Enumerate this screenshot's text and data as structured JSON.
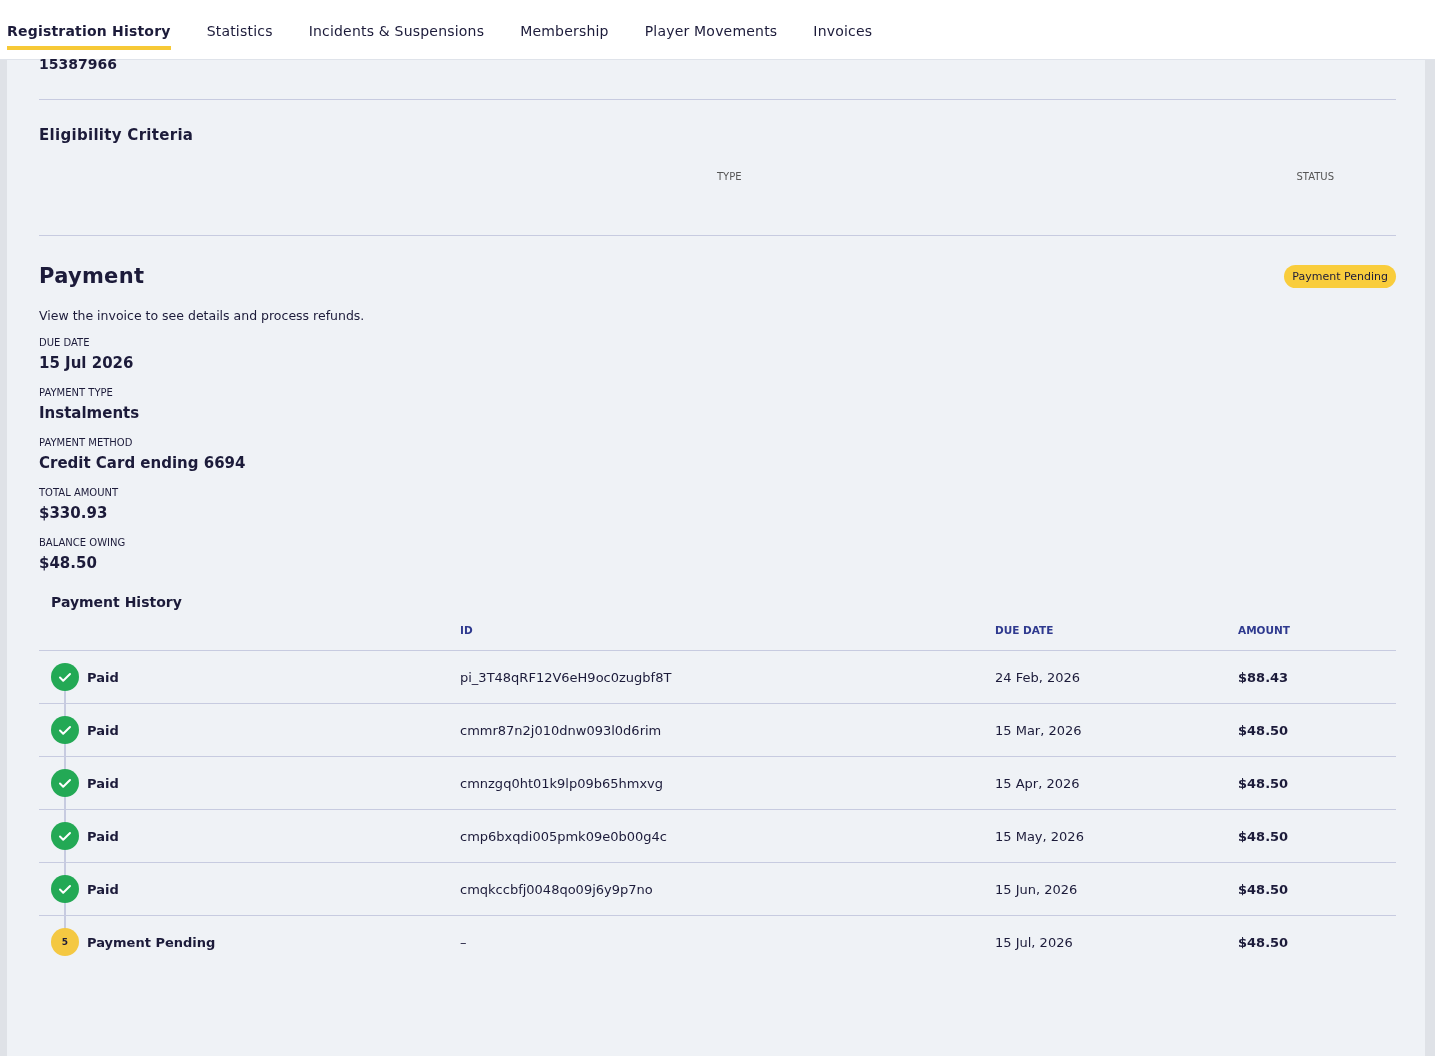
{
  "tabs": [
    {
      "label": "Registration History",
      "selected": true
    },
    {
      "label": "Statistics",
      "selected": false
    },
    {
      "label": "Incidents & Suspensions",
      "selected": false
    },
    {
      "label": "Membership",
      "selected": false
    },
    {
      "label": "Player Movements",
      "selected": false
    },
    {
      "label": "Invoices",
      "selected": false
    }
  ],
  "registration_number": "15387966",
  "eligibility": {
    "title": "Eligibility Criteria",
    "columns": [
      "TYPE",
      "STATUS"
    ]
  },
  "payment": {
    "title": "Payment",
    "badge": "Payment Pending",
    "description": "View the invoice to see details and process refunds.",
    "fields": [
      {
        "label": "DUE DATE",
        "value": "15 Jul 2026"
      },
      {
        "label": "PAYMENT TYPE",
        "value": "Instalments"
      },
      {
        "label": "PAYMENT METHOD",
        "value": "Credit Card ending 6694"
      },
      {
        "label": "TOTAL AMOUNT",
        "value": "$330.93"
      },
      {
        "label": "BALANCE OWING",
        "value": "$48.50"
      }
    ]
  },
  "payment_history": {
    "title": "Payment History",
    "columns": [
      "ID",
      "DUE DATE",
      "AMOUNT"
    ],
    "rows": [
      {
        "kind": "paid",
        "status": "Paid",
        "id": "pi_3T48qRF12V6eH9oc0zugbf8T",
        "due_date": "24 Feb, 2026",
        "amount": "$88.43"
      },
      {
        "kind": "paid",
        "status": "Paid",
        "id": "cmmr87n2j010dnw093l0d6rim",
        "due_date": "15 Mar, 2026",
        "amount": "$48.50"
      },
      {
        "kind": "paid",
        "status": "Paid",
        "id": "cmnzgq0ht01k9lp09b65hmxvg",
        "due_date": "15 Apr, 2026",
        "amount": "$48.50"
      },
      {
        "kind": "paid",
        "status": "Paid",
        "id": "cmp6bxqdi005pmk09e0b00g4c",
        "due_date": "15 May, 2026",
        "amount": "$48.50"
      },
      {
        "kind": "paid",
        "status": "Paid",
        "id": "cmqkccbfj0048qo09j6y9p7no",
        "due_date": "15 Jun, 2026",
        "amount": "$48.50"
      },
      {
        "kind": "pending",
        "step": "5",
        "status": "Payment Pending",
        "id": "–",
        "due_date": "15 Jul, 2026",
        "amount": "$48.50"
      }
    ]
  }
}
